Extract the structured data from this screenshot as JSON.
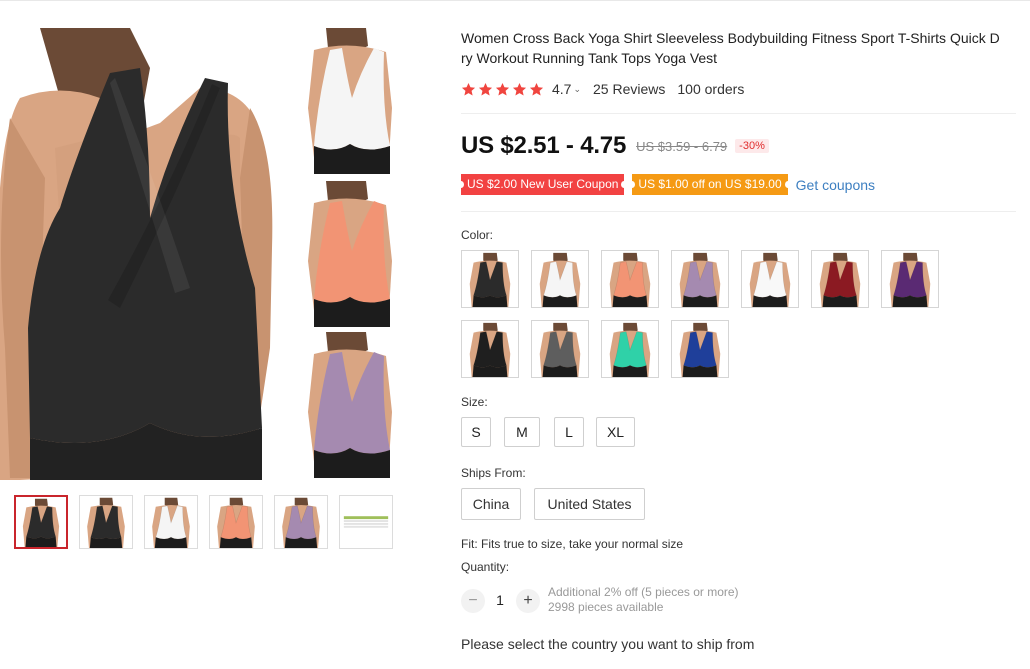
{
  "product": {
    "title": "Women Cross Back Yoga Shirt Sleeveless Bodybuilding Fitness Sport T-Shirts Quick Dry Workout Running Tank Tops Yoga Vest",
    "title_line1": "Women Cross Back Yoga Shirt Sleeveless Bodybuilding Fitness Sport T-Shirts Quick D",
    "title_line2": "ry Workout Running Tank Tops Yoga Vest",
    "rating": "4.7",
    "rating_stars": 5,
    "reviews": "25 Reviews",
    "orders": "100 orders"
  },
  "price": {
    "current": "US $2.51 - 4.75",
    "original": "US $3.59 - 6.79",
    "discount": "-30%"
  },
  "coupons": {
    "new_user": "US $2.00 New User Coupon",
    "store": "US $1.00 off on US $19.00",
    "get_coupons": "Get coupons"
  },
  "colors": {
    "label": "Color:",
    "options": [
      {
        "name": "black",
        "hex": "#2b2b2b"
      },
      {
        "name": "white",
        "hex": "#f5f5f5"
      },
      {
        "name": "coral",
        "hex": "#f29474"
      },
      {
        "name": "lavender",
        "hex": "#a58ab0"
      },
      {
        "name": "white-racerback",
        "hex": "#f8f8f8"
      },
      {
        "name": "burgundy",
        "hex": "#8b1a22"
      },
      {
        "name": "purple",
        "hex": "#5a2a73"
      },
      {
        "name": "black-racerback",
        "hex": "#1f1f1f"
      },
      {
        "name": "gray",
        "hex": "#5e5e5e"
      },
      {
        "name": "mint",
        "hex": "#2fd1a8"
      },
      {
        "name": "royal-blue",
        "hex": "#1f3f9a"
      }
    ]
  },
  "sizes": {
    "label": "Size:",
    "options": [
      "S",
      "M",
      "L",
      "XL"
    ]
  },
  "ships_from": {
    "label": "Ships From:",
    "options": [
      "China",
      "United States"
    ]
  },
  "fit": "Fit: Fits true to size, take your normal size",
  "quantity": {
    "label": "Quantity:",
    "minus": "−",
    "plus": "+",
    "value": "1",
    "note_line1": "Additional 2% off (5 pieces or more)",
    "note_line2": "2998 pieces available"
  },
  "ship_country_prompt": "Please select the country you want to ship from",
  "theme": {
    "accent_red": "#f24242",
    "accent_orange": "#f59a14",
    "link_blue": "#3d7fc1",
    "star_color": "#f0453f"
  },
  "gallery": {
    "main_color": "#2b2b2b",
    "side_colors": [
      "#f5f5f5",
      "#f29474",
      "#a58ab0"
    ],
    "thumb_colors": [
      "#2b2b2b",
      "#2b2b2b",
      "#f5f5f5",
      "#f29474",
      "#a58ab0",
      "size-chart"
    ]
  }
}
